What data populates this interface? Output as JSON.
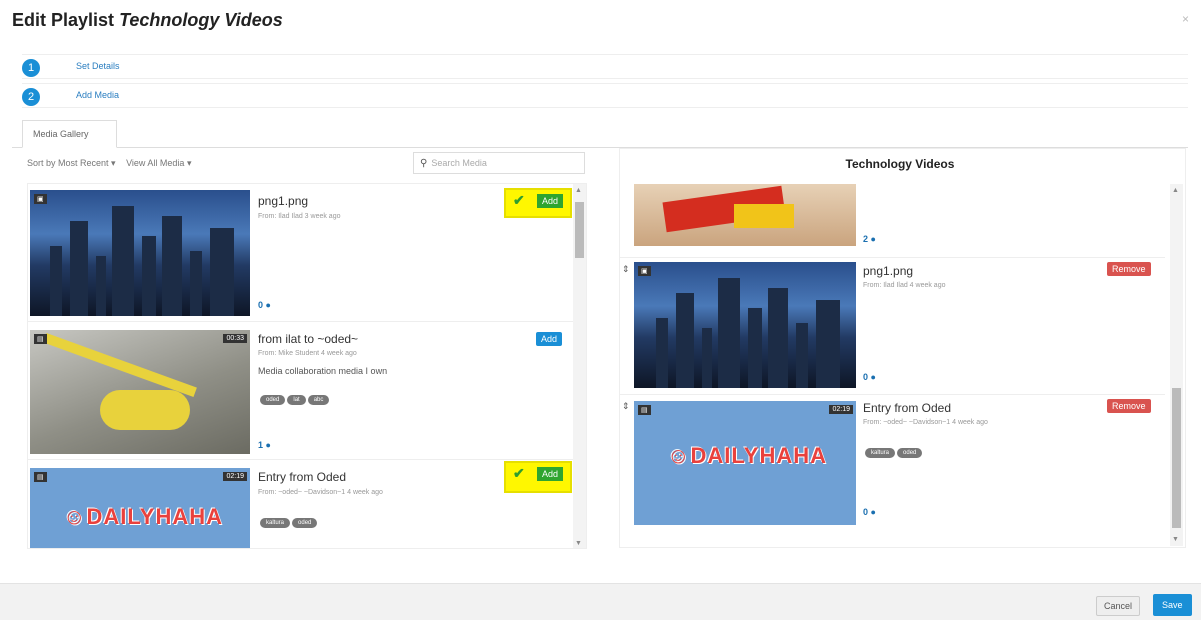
{
  "header": {
    "prefix": "Edit Playlist",
    "playlist_name": "Technology Videos",
    "close": "×"
  },
  "steps": [
    {
      "num": "1",
      "label": "Set Details"
    },
    {
      "num": "2",
      "label": "Add Media"
    }
  ],
  "tab": {
    "label": "Media Gallery"
  },
  "toolbar": {
    "sort": "Sort by Most Recent ▾",
    "filter": "View All Media ▾",
    "search_placeholder": "Search Media"
  },
  "gallery": [
    {
      "title": "png1.png",
      "from": "From: Ilad Ilad 3 week ago",
      "desc": "",
      "tags": [],
      "comments": "0",
      "badge_left": "img",
      "duration": "",
      "action": "Add",
      "highlighted": true
    },
    {
      "title": "from ilat to ~oded~",
      "from": "From: Mike Student 4 week ago",
      "desc": "Media collaboration media I own",
      "tags": [
        "oded",
        "lat",
        "abc"
      ],
      "comments": "1",
      "badge_left": "vid",
      "duration": "00:33",
      "action": "Add",
      "highlighted": false
    },
    {
      "title": "Entry from Oded",
      "from": "From: ~oded~ ~Davidson~1 4 week ago",
      "desc": "",
      "tags": [
        "kaltura",
        "oded"
      ],
      "comments": "",
      "badge_left": "vid",
      "duration": "02:19",
      "action": "Add",
      "highlighted": true
    }
  ],
  "playlist": {
    "title": "Technology Videos",
    "items": [
      {
        "title": "",
        "from": "",
        "tags": [],
        "comments": "2",
        "action": ""
      },
      {
        "title": "png1.png",
        "from": "From: Ilad Ilad 4 week ago",
        "tags": [],
        "comments": "0",
        "duration": "",
        "action": "Remove"
      },
      {
        "title": "Entry from Oded",
        "from": "From: ~oded~ ~Davidson~1 4 week ago",
        "tags": [
          "kaltura",
          "oded"
        ],
        "comments": "0",
        "duration": "02:19",
        "action": "Remove"
      }
    ]
  },
  "footer": {
    "cancel": "Cancel",
    "save": "Save"
  },
  "icons": {
    "comment": "comment-icon",
    "search": "search-icon",
    "check": "check-icon",
    "drag": "drag-handle-icon"
  }
}
